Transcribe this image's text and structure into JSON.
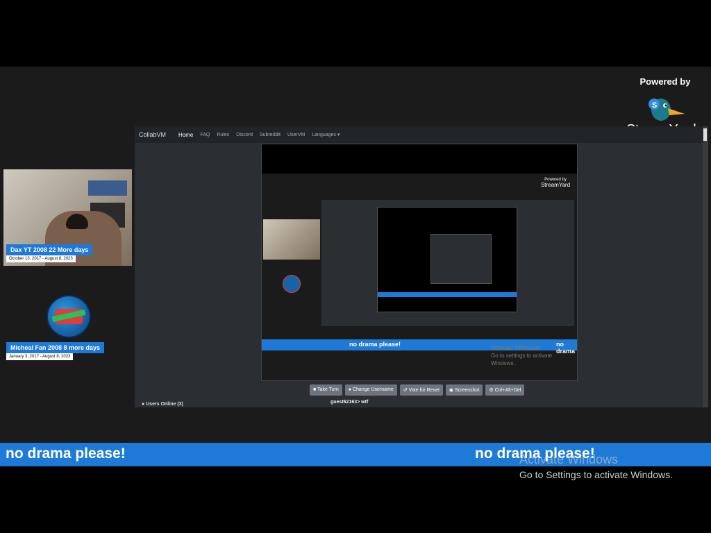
{
  "streamyard": {
    "powered_by": "Powered by",
    "name": "StreamYard"
  },
  "participants": [
    {
      "name": "Dax YT 2008 22 More days",
      "dates": "October 13, 2017 - August 8, 2023"
    },
    {
      "name": "Micheal Fan 2008 8 more days",
      "dates": "January 3, 2017 - August 8, 2023"
    }
  ],
  "browser": {
    "brand": "CollabVM",
    "nav": [
      "Home",
      "FAQ",
      "Rules",
      "Discord",
      "Subreddit",
      "UserVM",
      "Languages ▾"
    ]
  },
  "vm": {
    "ticker_left": "no drama please!",
    "ticker_right": "no drama",
    "inner_powered_by": "Powered by",
    "inner_name": "StreamYard",
    "activate_title": "Activate Windows",
    "activate_sub": "Go to settings to activate Windows."
  },
  "controls": {
    "take_turn": "Take Turn",
    "change_username": "Change Username",
    "vote_reset": "Vote for Reset",
    "screenshot": "Screenshot",
    "ctrl_alt_del": "Ctrl+Alt+Del"
  },
  "chat": {
    "line": "guest62163> wtf"
  },
  "users_online": "Users Online (3)",
  "bottom_ticker": {
    "left": "no drama please!",
    "right": "no drama please!"
  },
  "activate": {
    "title": "Activate Windows",
    "sub": "Go to Settings to activate Windows."
  }
}
